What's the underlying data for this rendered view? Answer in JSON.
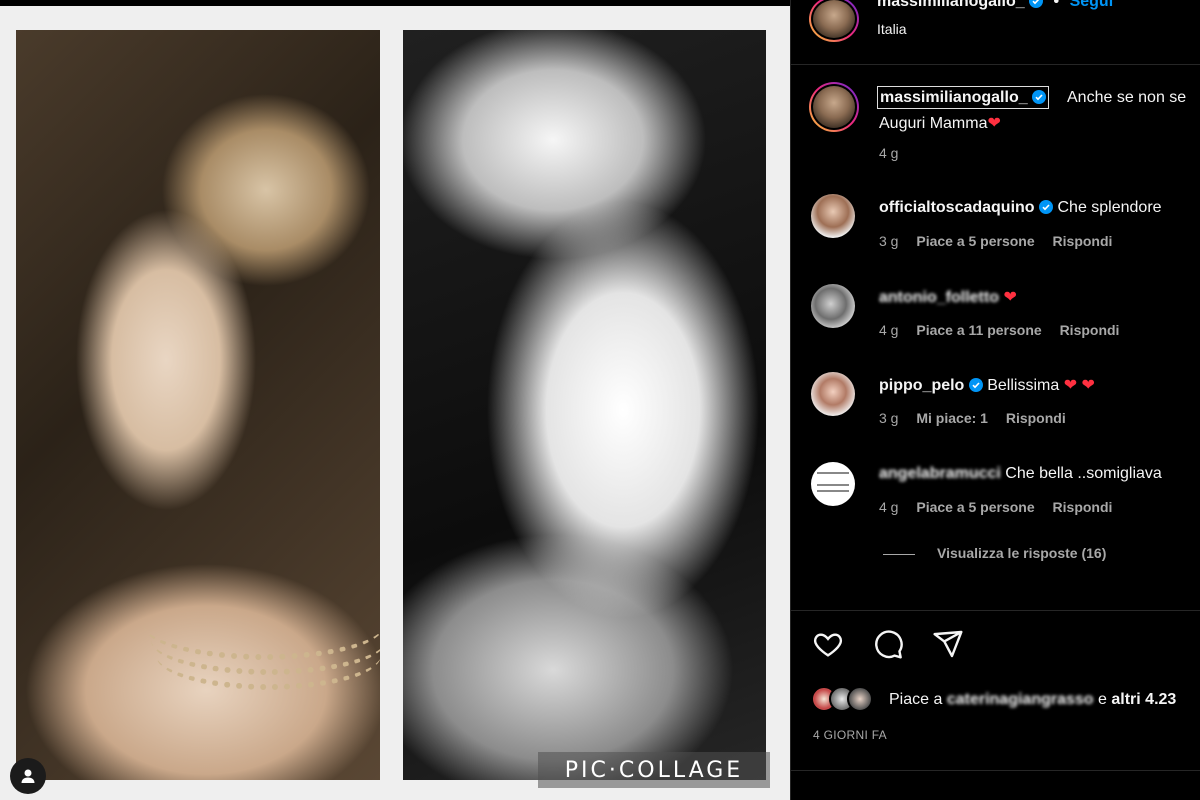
{
  "post": {
    "watermark": "PIC·COLLAGE"
  },
  "header": {
    "username": "massimilianogallo_",
    "follow": "Segui",
    "location": "Italia",
    "separator": "•"
  },
  "caption": {
    "username": "massimilianogallo_",
    "text": "Anche se non se",
    "line2": "Auguri Mamma",
    "time": "4 g"
  },
  "comments": [
    {
      "user": "officialtoscadaquino",
      "text": "Che splendore",
      "time": "3 g",
      "likes": "Piace a 5 persone",
      "reply": "Rispondi"
    },
    {
      "user": "antonio_folletto",
      "text": "",
      "time": "4 g",
      "likes": "Piace a 11 persone",
      "reply": "Rispondi"
    },
    {
      "user": "pippo_pelo",
      "text": "Bellissima",
      "time": "3 g",
      "likes": "Mi piace: 1",
      "reply": "Rispondi"
    },
    {
      "user": "angelabramucci",
      "text": "Che bella ..somigliava",
      "time": "4 g",
      "likes": "Piace a 5 persone",
      "reply": "Rispondi"
    }
  ],
  "view_replies": "Visualizza le risposte (16)",
  "likes": {
    "prefix": "Piace a",
    "user": "caterinagiangrasso",
    "joiner": "e",
    "others": "altri 4.23"
  },
  "date": "4 GIORNI FA",
  "colors": {
    "accent": "#0095f6",
    "heart": "#ff3040",
    "muted": "#a8a8a8"
  },
  "icons": [
    "verified-icon",
    "heart-icon",
    "comment-icon",
    "share-icon",
    "user-tag-icon"
  ]
}
